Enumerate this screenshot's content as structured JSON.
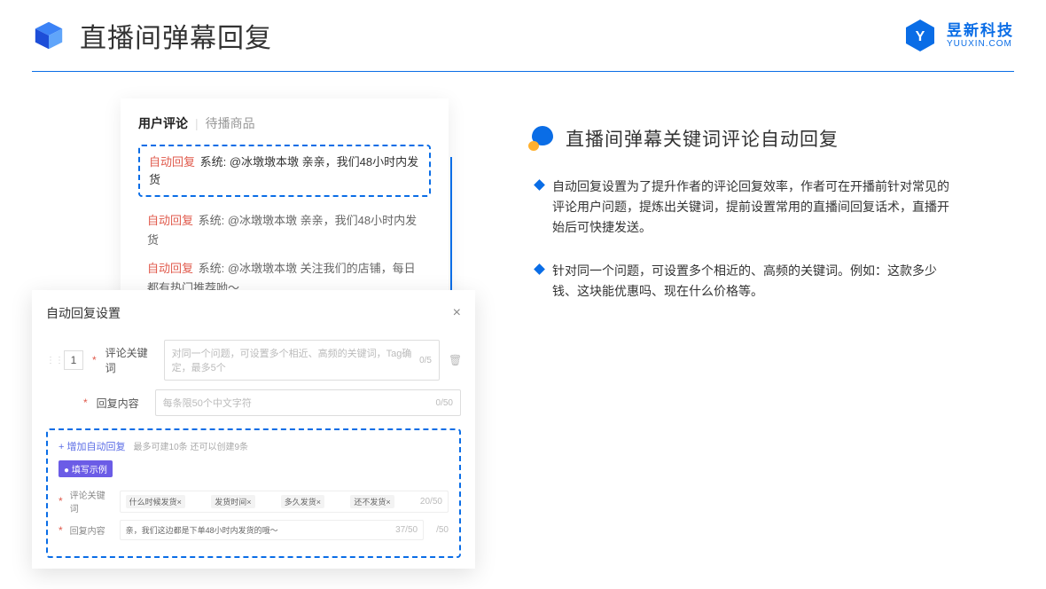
{
  "header": {
    "title": "直播间弹幕回复",
    "logo_cn": "昱新科技",
    "logo_en": "YUUXIN.COM"
  },
  "comments": {
    "tab_active": "用户评论",
    "tab_2": "待播商品",
    "auto_label": "自动回复",
    "row1": "系统: @冰墩墩本墩 亲亲，我们48小时内发货",
    "row2": "系统: @冰墩墩本墩 亲亲，我们48小时内发货",
    "row3": "系统: @冰墩墩本墩 关注我们的店铺，每日都有热门推荐呦～"
  },
  "modal": {
    "title": "自动回复设置",
    "order": "1",
    "kw_label": "评论关键词",
    "kw_placeholder": "对同一个问题，可设置多个相近、高频的关键词，Tag确定，最多5个",
    "kw_counter": "0/5",
    "reply_label": "回复内容",
    "reply_placeholder": "每条限50个中文字符",
    "reply_counter": "0/50",
    "add_link": "+ 增加自动回复",
    "add_hint": "最多可建10条 还可以创建9条",
    "example_tag": "● 填写示例",
    "ex_kw_label": "评论关键词",
    "ex_tags": [
      "什么时候发货×",
      "发货时间×",
      "多久发货×",
      "还不发货×"
    ],
    "ex_kw_counter": "20/50",
    "ex_reply_label": "回复内容",
    "ex_reply_value": "亲，我们这边都是下单48小时内发货的哦～",
    "ex_reply_counter": "37/50",
    "outer_counter": "/50"
  },
  "right": {
    "feature_title": "直播间弹幕关键词评论自动回复",
    "bullet1": "自动回复设置为了提升作者的评论回复效率，作者可在开播前针对常见的评论用户问题，提炼出关键词，提前设置常用的直播间回复话术，直播开始后可快捷发送。",
    "bullet2": "针对同一个问题，可设置多个相近的、高频的关键词。例如：这款多少钱、这块能优惠吗、现在什么价格等。"
  }
}
